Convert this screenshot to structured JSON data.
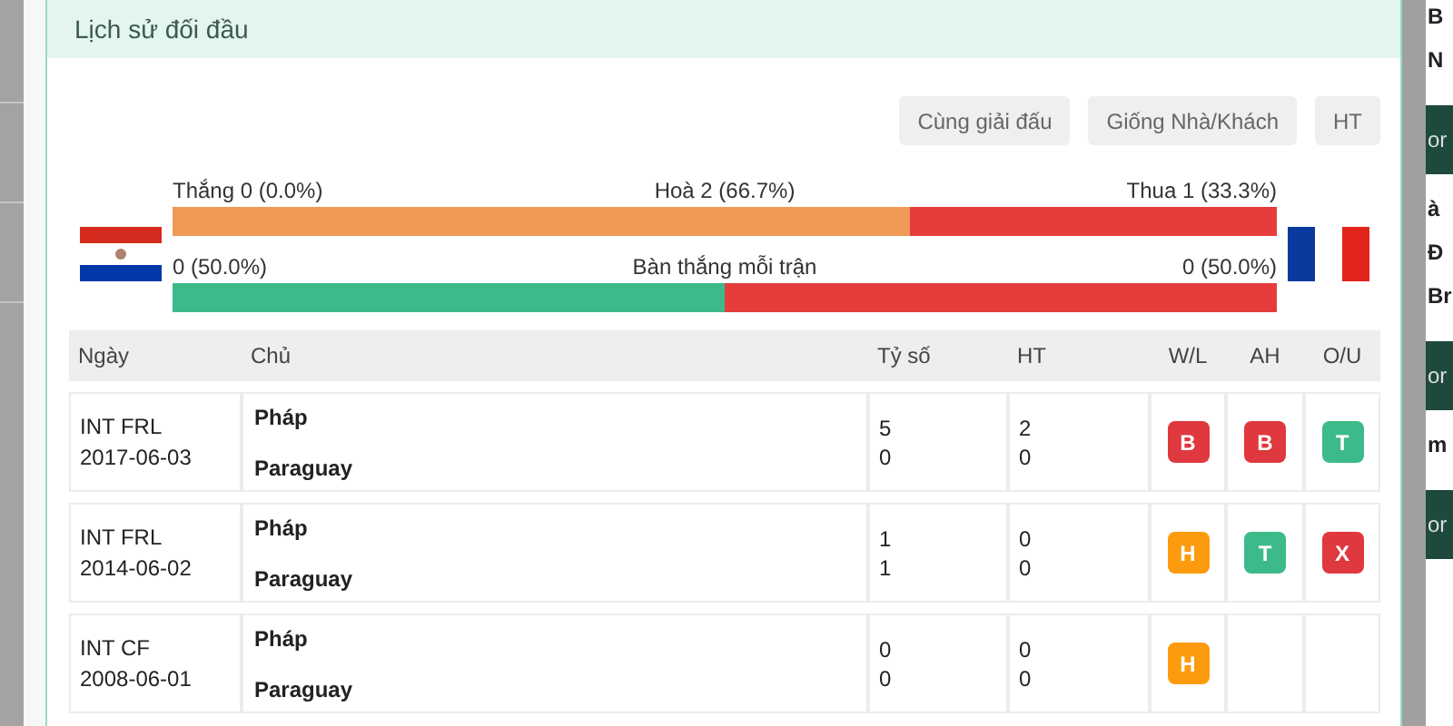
{
  "panel": {
    "title": "Lịch sử đối đầu"
  },
  "filters": [
    {
      "label": "Cùng giải đấu"
    },
    {
      "label": "Giống Nhà/Khách"
    },
    {
      "label": "HT"
    }
  ],
  "result_bar": {
    "left_label": "Thắng 0 (0.0%)",
    "middle_label": "Hoà 2 (66.7%)",
    "right_label": "Thua 1 (33.3%)",
    "segments": [
      {
        "level": 0.667,
        "color": "#ef9a56"
      },
      {
        "level": 0.333,
        "color": "#e63c3c"
      }
    ]
  },
  "goals_bar": {
    "left_label": "0 (50.0%)",
    "middle_label": "Bàn thắng mỗi trận",
    "right_label": "0 (50.0%)",
    "segments": [
      {
        "level": 0.5,
        "color": "#3dba8a"
      },
      {
        "level": 0.5,
        "color": "#e63c3c"
      }
    ]
  },
  "table": {
    "columns": [
      "Ngày",
      "Chủ",
      "Tỷ số",
      "HT",
      "W/L",
      "AH",
      "O/U"
    ],
    "rows": [
      {
        "competition": "INT FRL",
        "date": "2017-06-03",
        "home": "Pháp",
        "away": "Paraguay",
        "score": [
          "5",
          "0"
        ],
        "ht": [
          "2",
          "0"
        ],
        "wl": {
          "text": "B",
          "color": "#e0383f"
        },
        "ah": {
          "text": "B",
          "color": "#e0383f"
        },
        "ou": {
          "text": "T",
          "color": "#3dba8a"
        }
      },
      {
        "competition": "INT FRL",
        "date": "2014-06-02",
        "home": "Pháp",
        "away": "Paraguay",
        "score": [
          "1",
          "1"
        ],
        "ht": [
          "0",
          "0"
        ],
        "wl": {
          "text": "H",
          "color": "#fd9b0f"
        },
        "ah": {
          "text": "T",
          "color": "#3dba8a"
        },
        "ou": {
          "text": "X",
          "color": "#e0383f"
        }
      },
      {
        "competition": "INT CF",
        "date": "2008-06-01",
        "home": "Pháp",
        "away": "Paraguay",
        "score": [
          "0",
          "0"
        ],
        "ht": [
          "0",
          "0"
        ],
        "wl": {
          "text": "H",
          "color": "#fd9b0f"
        }
      }
    ]
  },
  "right_sidebar": [
    {
      "kind": "text",
      "text": "B"
    },
    {
      "kind": "text",
      "text": "N"
    },
    {
      "kind": "dark",
      "text": "or"
    },
    {
      "kind": "text",
      "text": "à"
    },
    {
      "kind": "text",
      "text": "Đ"
    },
    {
      "kind": "text",
      "text": "Br"
    },
    {
      "kind": "dark",
      "text": "or"
    },
    {
      "kind": "text",
      "text": "m"
    },
    {
      "kind": "dark",
      "text": "or"
    }
  ]
}
